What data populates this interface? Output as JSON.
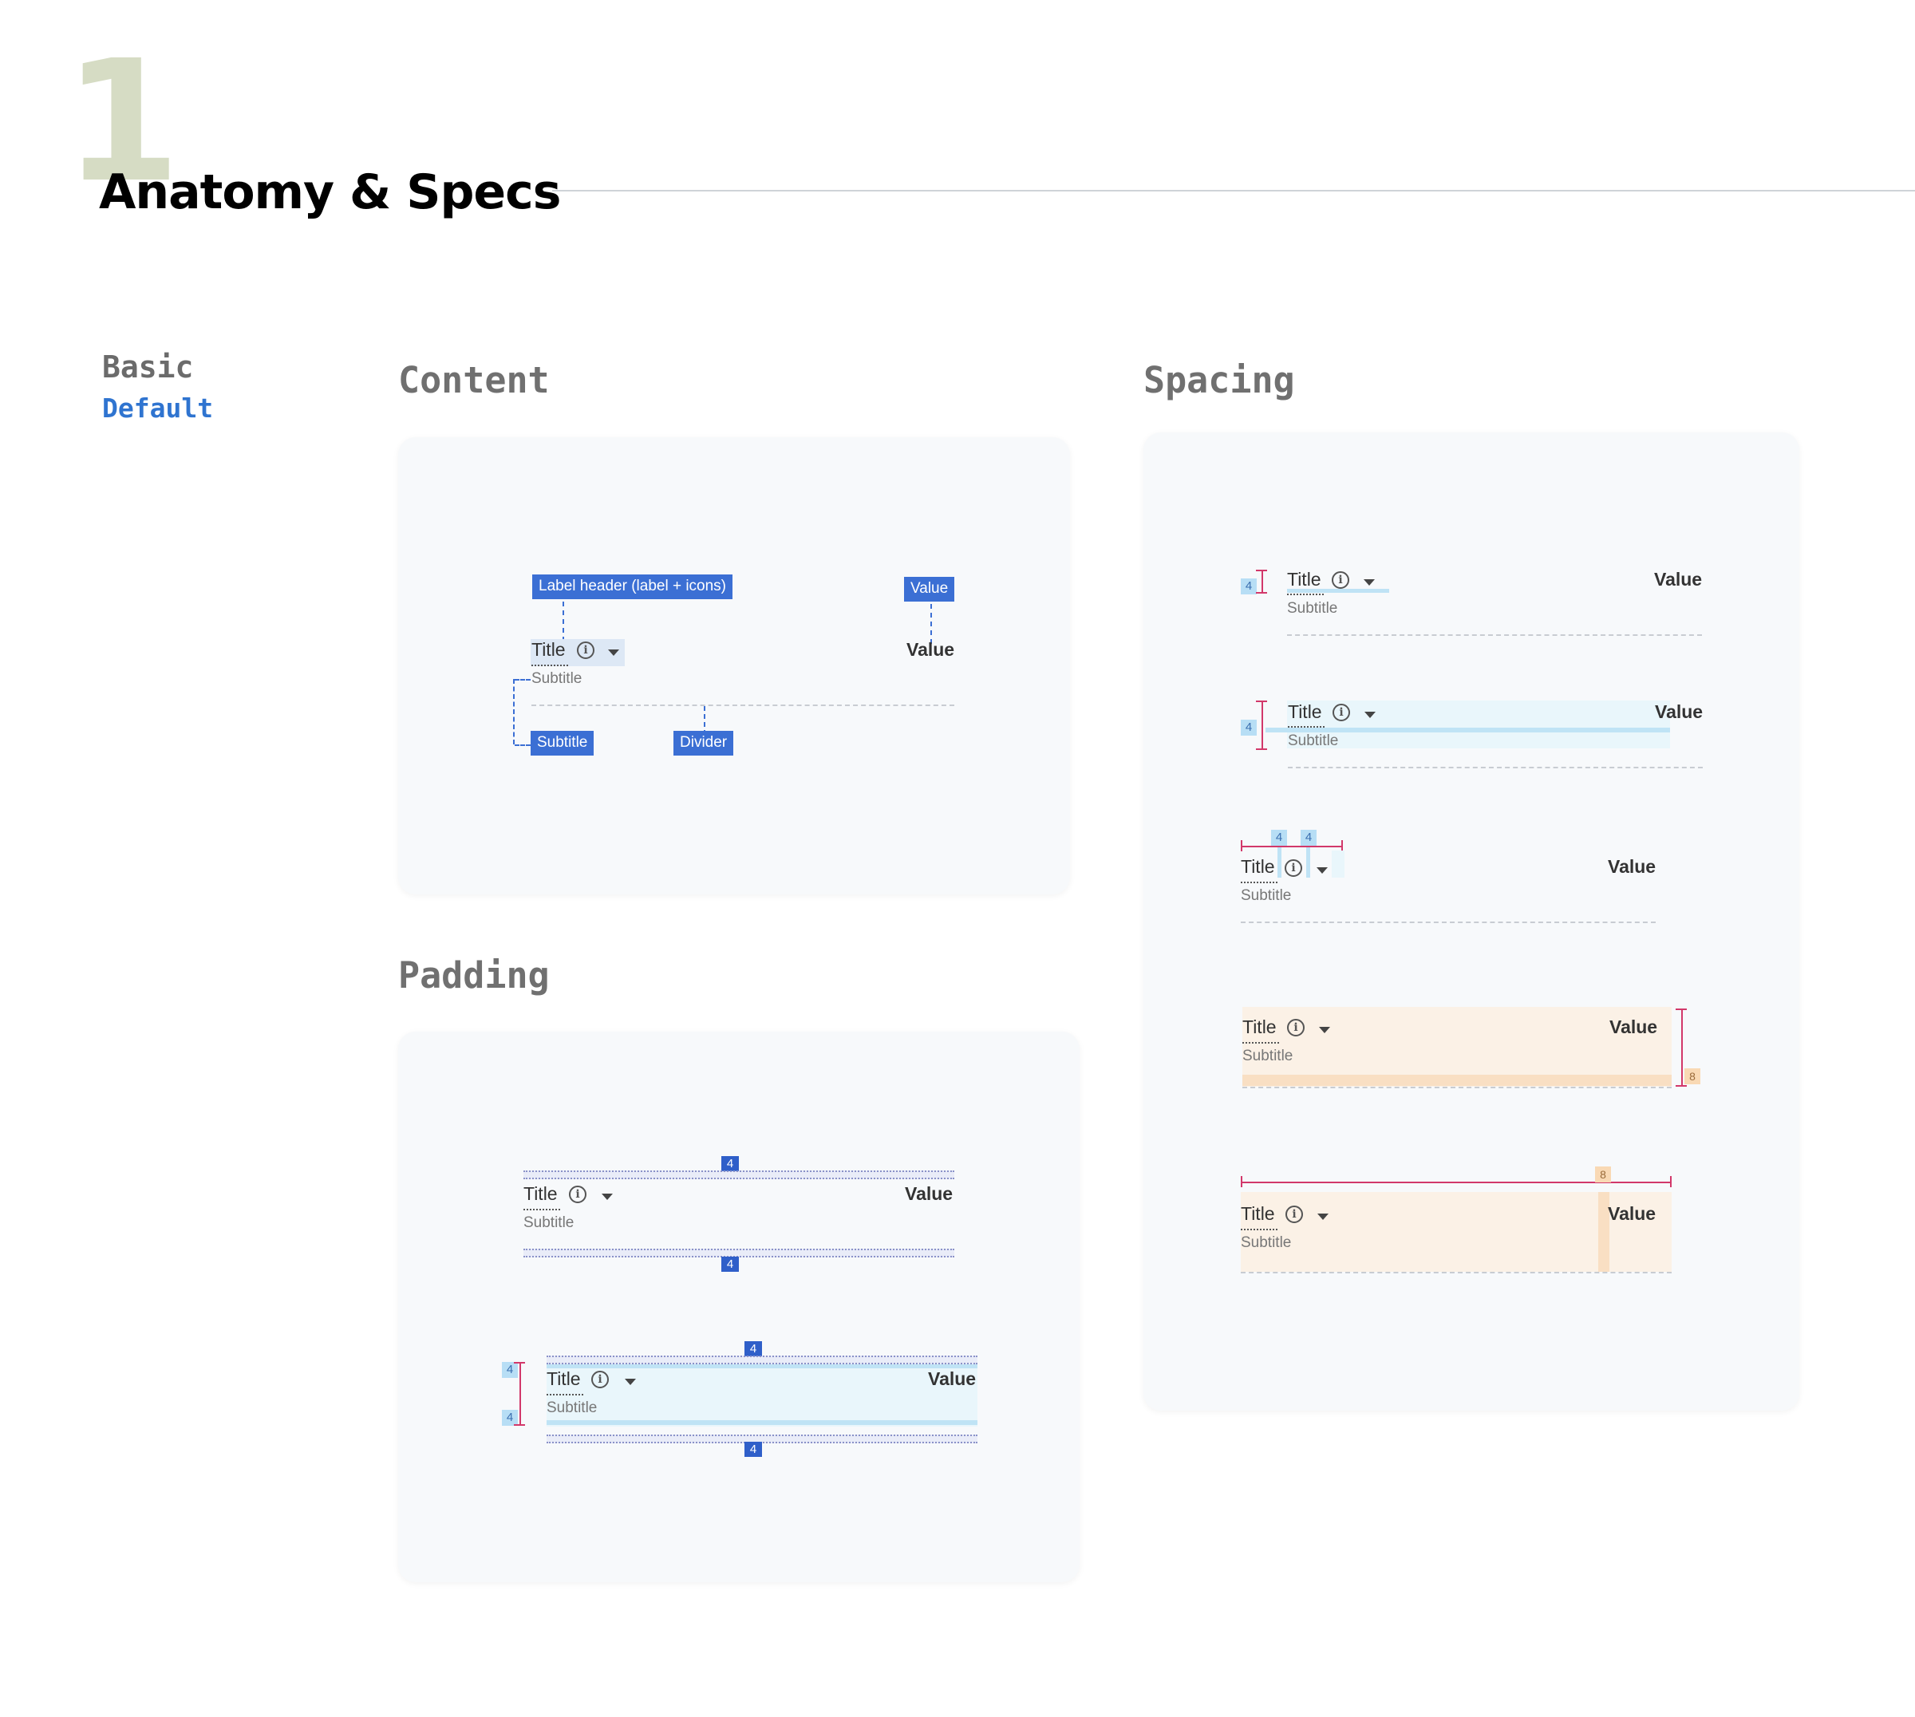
{
  "header": {
    "number": "1",
    "title": "Anatomy & Specs"
  },
  "category": {
    "main": "Basic",
    "sub": "Default"
  },
  "sections": {
    "content": "Content",
    "padding": "Padding",
    "spacing": "Spacing"
  },
  "item": {
    "title": "Title",
    "subtitle": "Subtitle",
    "value": "Value",
    "info_icon": "info-icon",
    "dropdown_icon": "caret-down-icon"
  },
  "content_tags": {
    "label_header": "Label header (label + icons)",
    "value": "Value",
    "subtitle": "Subtitle",
    "divider": "Divider"
  },
  "measurements": {
    "four": "4",
    "eight": "8"
  },
  "colors": {
    "accent_blue": "#3b6fd4",
    "measure_pink": "#d2386a",
    "padding_light_blue": "#bfe3f5",
    "spacing_peach": "#f9dfc3",
    "panel_bg": "#f7f9fb"
  }
}
